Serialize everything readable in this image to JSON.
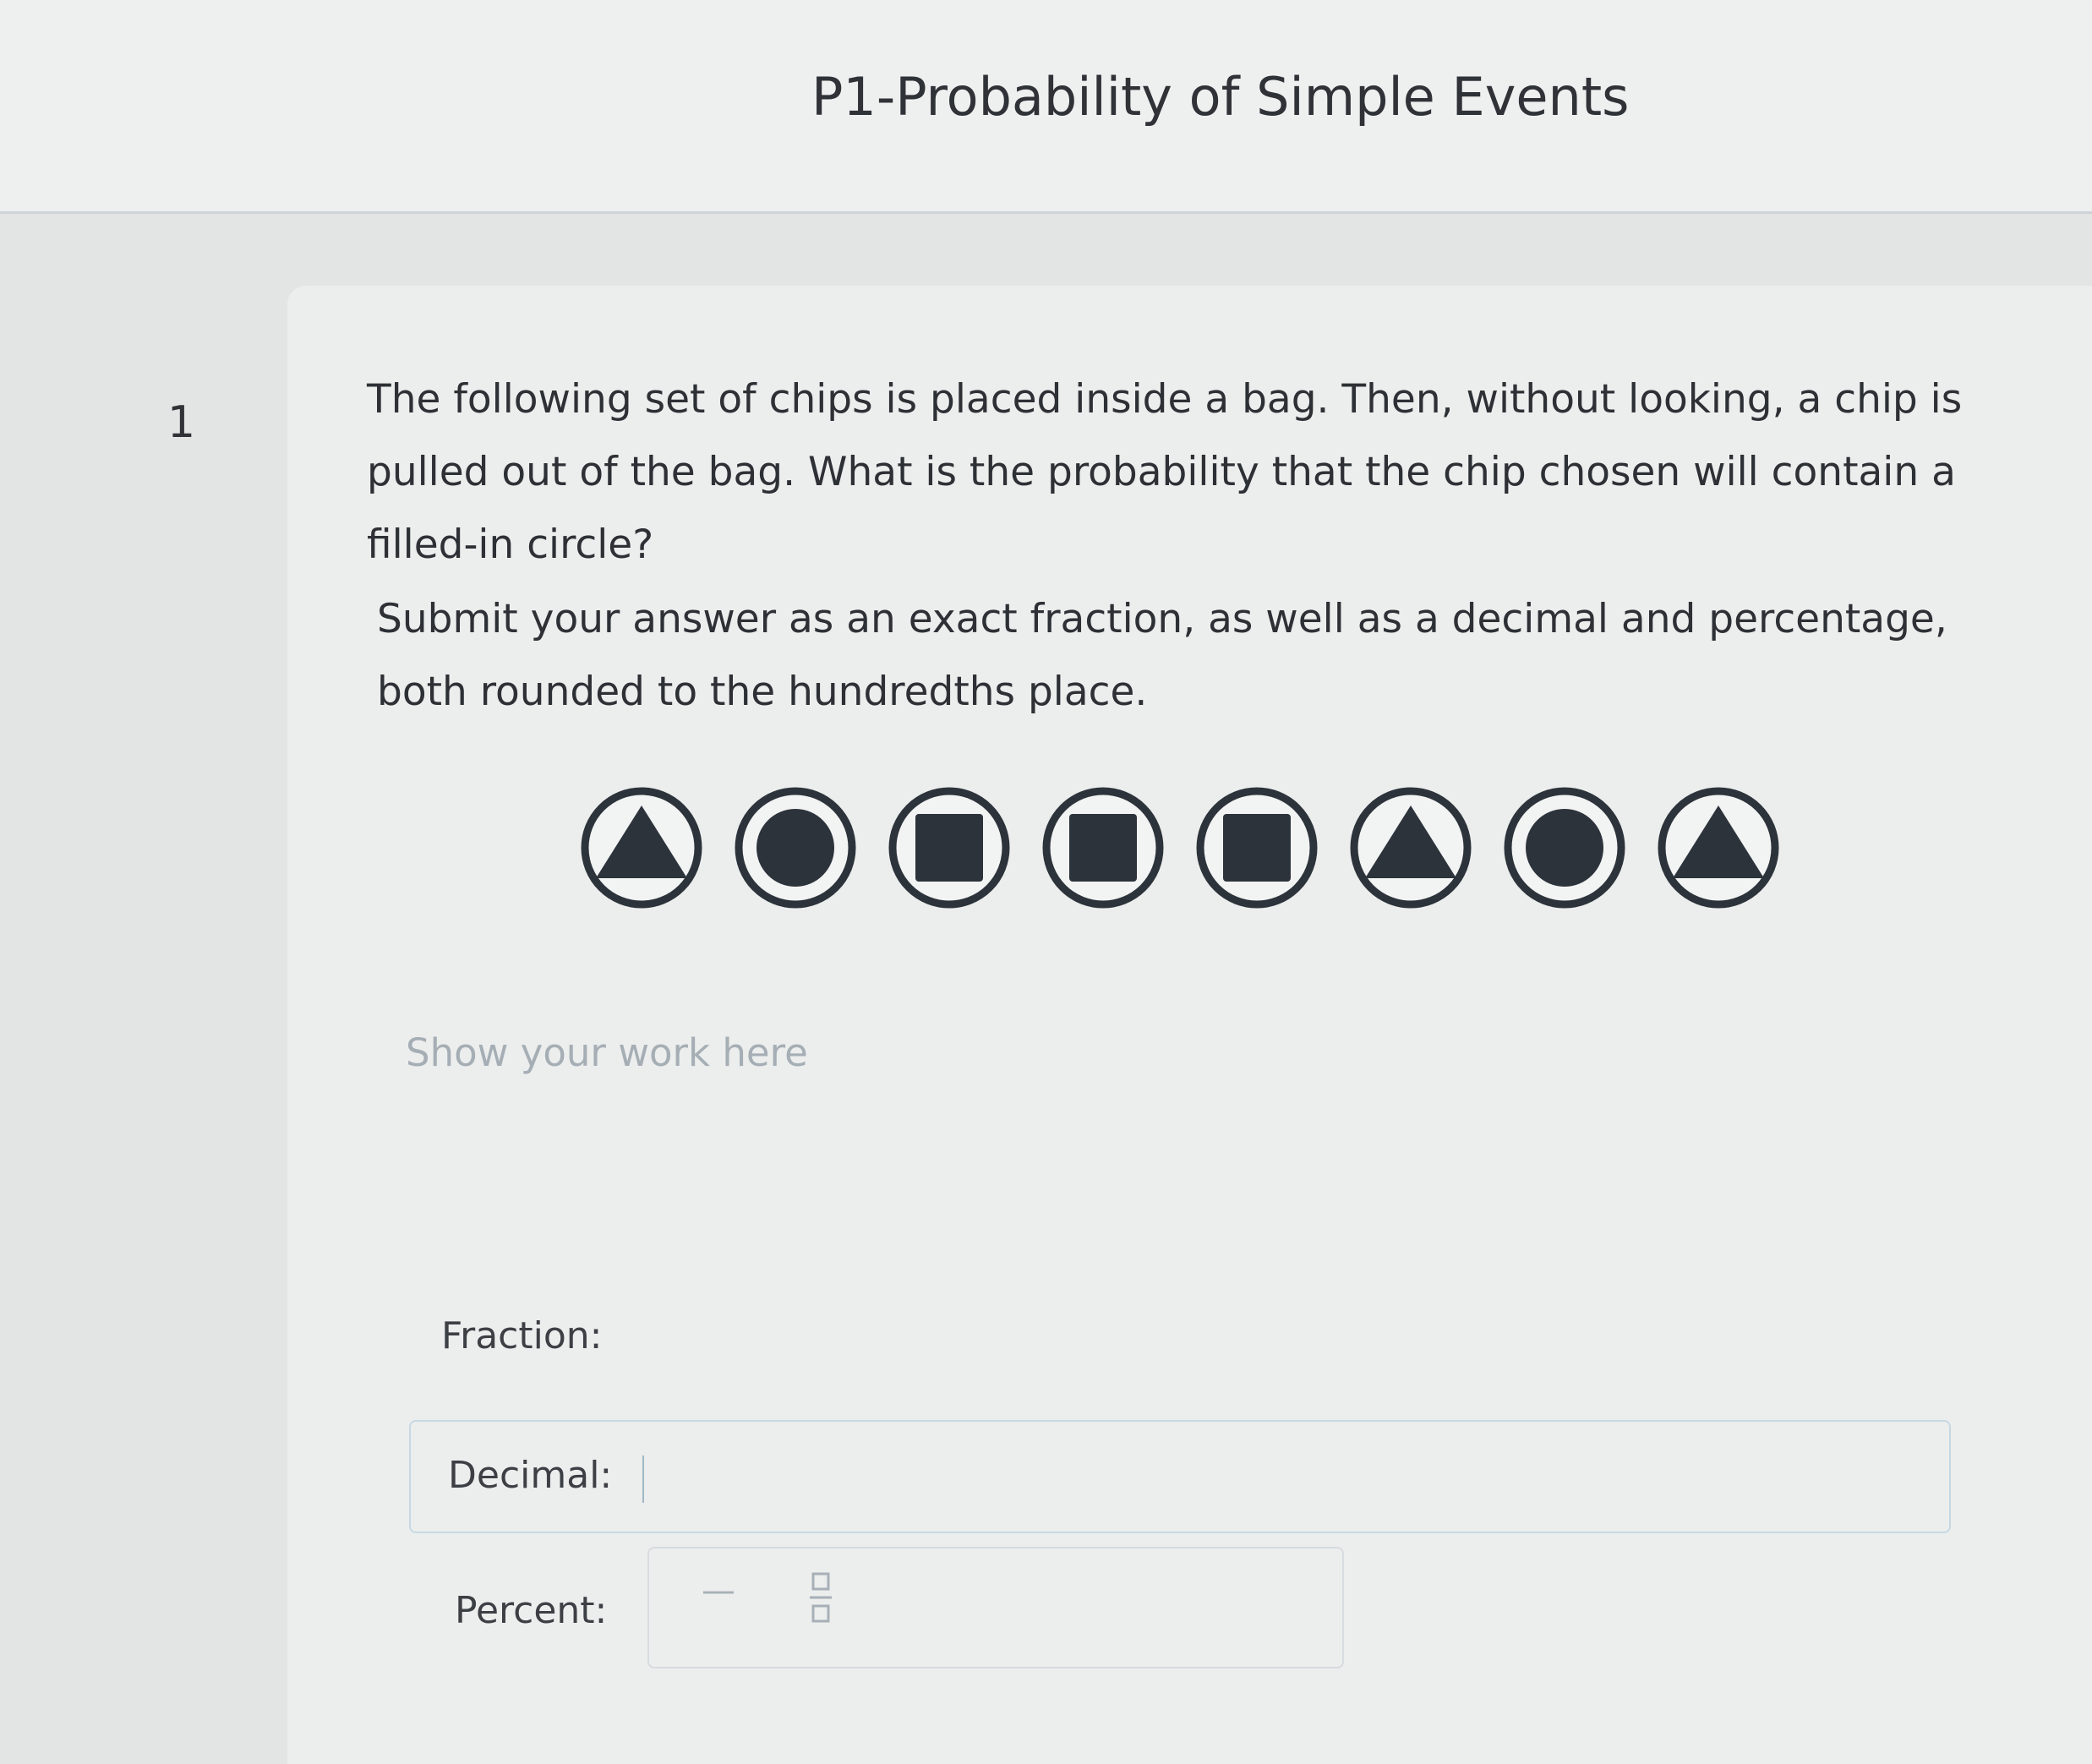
{
  "header": {
    "title": "P1-Probability of Simple Events"
  },
  "question": {
    "number": "1",
    "prompt": "The following set of chips is placed inside a bag. Then, without looking, a chip is pulled out of the bag. What is the probability that the chip chosen will contain a filled-in circle?",
    "instructions": "Submit your answer as an exact fraction, as well as a decimal and percentage, both rounded to the hundredths place.",
    "chips": [
      "triangle",
      "circle",
      "square",
      "square",
      "square",
      "triangle",
      "circle",
      "triangle"
    ]
  },
  "work": {
    "placeholder": "Show your work here"
  },
  "answers": {
    "fraction_label": "Fraction:",
    "decimal_label": "Decimal:",
    "percent_label": "Percent:",
    "minus_symbol": "—"
  },
  "colors": {
    "chip_fill": "#2c333b",
    "chip_ring": "#2c333b",
    "placeholder": "#a6aeb5"
  }
}
